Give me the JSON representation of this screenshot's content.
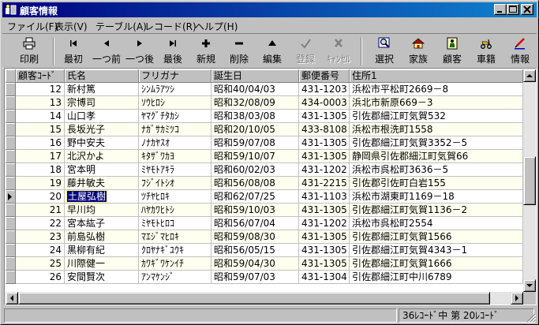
{
  "window": {
    "title": "顧客情報",
    "icon": "app-icon",
    "controls": [
      "minimize-icon",
      "maximize-icon",
      "close-icon"
    ]
  },
  "menu": [
    {
      "label": "ファイル(F)"
    },
    {
      "label": "表示(V)"
    },
    {
      "label": "テーブル(A)"
    },
    {
      "label": "レコード(R)"
    },
    {
      "label": "ヘルプ(H)"
    }
  ],
  "toolbar": [
    {
      "label": "印刷",
      "icon": "printer-icon",
      "enabled": true
    },
    {
      "label": "最初",
      "icon": "first-record-icon",
      "enabled": true
    },
    {
      "label": "一つ前",
      "icon": "previous-record-icon",
      "enabled": true
    },
    {
      "label": "一つ後",
      "icon": "next-record-icon",
      "enabled": true
    },
    {
      "label": "最後",
      "icon": "last-record-icon",
      "enabled": true
    },
    {
      "label": "新規",
      "icon": "plus-icon",
      "enabled": true
    },
    {
      "label": "削除",
      "icon": "minus-icon",
      "enabled": true
    },
    {
      "label": "編集",
      "icon": "edit-triangle-icon",
      "enabled": true
    },
    {
      "label": "登録",
      "icon": "checkmark-icon",
      "enabled": false
    },
    {
      "label": "ｷｬﾝｾﾙ",
      "icon": "cancel-x-icon",
      "enabled": false
    },
    {
      "label": "選択",
      "icon": "magnifier-icon",
      "enabled": true
    },
    {
      "label": "家族",
      "icon": "house-icon",
      "enabled": true
    },
    {
      "label": "顧客",
      "icon": "person-card-icon",
      "enabled": true
    },
    {
      "label": "車籍",
      "icon": "scooter-icon",
      "enabled": true
    },
    {
      "label": "情報",
      "icon": "pen-icon",
      "enabled": true
    }
  ],
  "grid": {
    "columns": [
      "顧客ｺｰﾄﾞ",
      "氏名",
      "フリガナ",
      "誕生日",
      "郵便番号",
      "住所1"
    ],
    "current_row_index": 8,
    "rows": [
      [
        "12",
        "新村篤",
        "ｼﾝﾑﾗｱﾂｼ",
        "昭和40/04/03",
        "431-1203",
        "浜松市平松町2669－8"
      ],
      [
        "13",
        "宗博司",
        "ｿｳﾋﾛｼ",
        "昭和32/08/09",
        "434-0003",
        "浜北市新原669－3"
      ],
      [
        "14",
        "山口孝",
        "ﾔﾏｸﾞﾁﾀｶｼ",
        "昭和38/03/08",
        "431-1305",
        "引佐郡細江町気賀532"
      ],
      [
        "15",
        "長坂光子",
        "ﾅｶﾞｻｶﾐﾂｺ",
        "昭和20/10/05",
        "433-8108",
        "浜松市根洗町1558"
      ],
      [
        "16",
        "野中安夫",
        "ﾉﾅｶﾔｽｵ",
        "昭和59/07/08",
        "431-1305",
        "引佐郡細江町気賀3352－5"
      ],
      [
        "17",
        "北沢かよ",
        "ｷﾀｻﾞﾜｶﾖ",
        "昭和59/10/07",
        "431-1305",
        "静岡県引佐郡細江町気賀66"
      ],
      [
        "18",
        "宮本明",
        "ﾐﾔﾓﾄｱｷﾗ",
        "昭和60/02/03",
        "431-1202",
        "浜松市呉松町3636－5"
      ],
      [
        "19",
        "藤井敏夫",
        "ﾌｼﾞｲﾄｼｵ",
        "昭和56/08/08",
        "431-2215",
        "引佐郡引佐町白岩155"
      ],
      [
        "20",
        "土屋弘樹",
        "ﾂﾁﾔﾋﾛｷ",
        "昭和62/07/25",
        "431-1103",
        "浜松市湖東町1169－18"
      ],
      [
        "21",
        "早川均",
        "ﾊﾔｶﾜﾋﾄｼ",
        "昭和59/10/03",
        "431-1305",
        "引佐郡細江町気賀1136－2"
      ],
      [
        "22",
        "宮本紘子",
        "ﾐﾔﾓﾄﾋﾛｺ",
        "昭和56/07/04",
        "431-1202",
        "浜松市呉松町2554"
      ],
      [
        "23",
        "前島弘樹",
        "ﾏｴｼﾞﾏﾋﾛｷ",
        "昭和59/08/30",
        "431-1305",
        "引佐郡細江町気賀1566"
      ],
      [
        "24",
        "黒柳有紀",
        "ｸﾛﾔﾅｷﾞﾕｳｷ",
        "昭和56/05/15",
        "431-1305",
        "引佐郡細江町気賀4343－1"
      ],
      [
        "25",
        "川際健一",
        "ｶﾜｷﾞﾜｹﾝｲﾁ",
        "昭和59/04/30",
        "431-1305",
        "引佐郡細江町気賀1666"
      ],
      [
        "26",
        "安間賢次",
        "ｱﾝﾏｹﾝｼﾞ",
        "昭和59/07/03",
        "431-1304",
        "引佐郡細江町中川6789"
      ]
    ]
  },
  "status": {
    "record_info": "36ﾚｺｰﾄﾞ中 第 20ﾚｺｰﾄﾞ"
  }
}
